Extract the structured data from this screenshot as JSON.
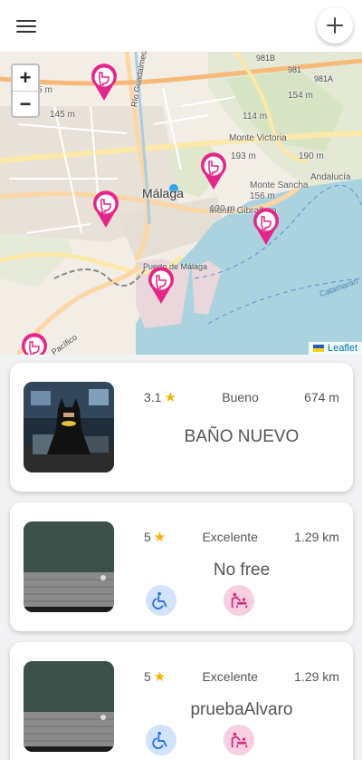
{
  "header": {
    "menu_icon": "menu-icon",
    "add_icon": "plus-icon",
    "add_label": "+"
  },
  "map": {
    "zoom_in": "+",
    "zoom_out": "−",
    "attribution": "Leaflet",
    "accent_color": "#e4268a",
    "labels": {
      "city": "Málaga",
      "road_guadalmedina": "Río Guadalmedina",
      "monte_victoria": "Monte Victoria",
      "monte_victoria_elev": "193 m",
      "monte_gibralfaro": "Monte Gibralfaro",
      "monte_gibralfaro_elev": "130 m",
      "monte_sancha": "Monte Sancha",
      "monte_sancha_elev": "156 m",
      "elev_114": "114 m",
      "elev_154": "154 m",
      "elev_190": "190 m",
      "elev_145": "145 m",
      "elev_155": "155 m",
      "road_981a": "981A",
      "road_981b": "981B",
      "road_981": "981",
      "andalucia": "Andalucía",
      "puerto": "Puerto de Málaga",
      "catamaran": "Catamaran",
      "pacifico": "Pacífico"
    }
  },
  "listings": [
    {
      "rating": "3.1",
      "quality": "Bueno",
      "distance": "674 m",
      "name": "BAÑO NUEVO",
      "amenities": []
    },
    {
      "rating": "5",
      "quality": "Excelente",
      "distance": "1.29 km",
      "name": "No free",
      "amenities": [
        "wheelchair-icon",
        "baby-changing-icon"
      ]
    },
    {
      "rating": "5",
      "quality": "Excelente",
      "distance": "1.29 km",
      "name": "pruebaAlvaro",
      "amenities": [
        "wheelchair-icon",
        "baby-changing-icon"
      ]
    }
  ]
}
